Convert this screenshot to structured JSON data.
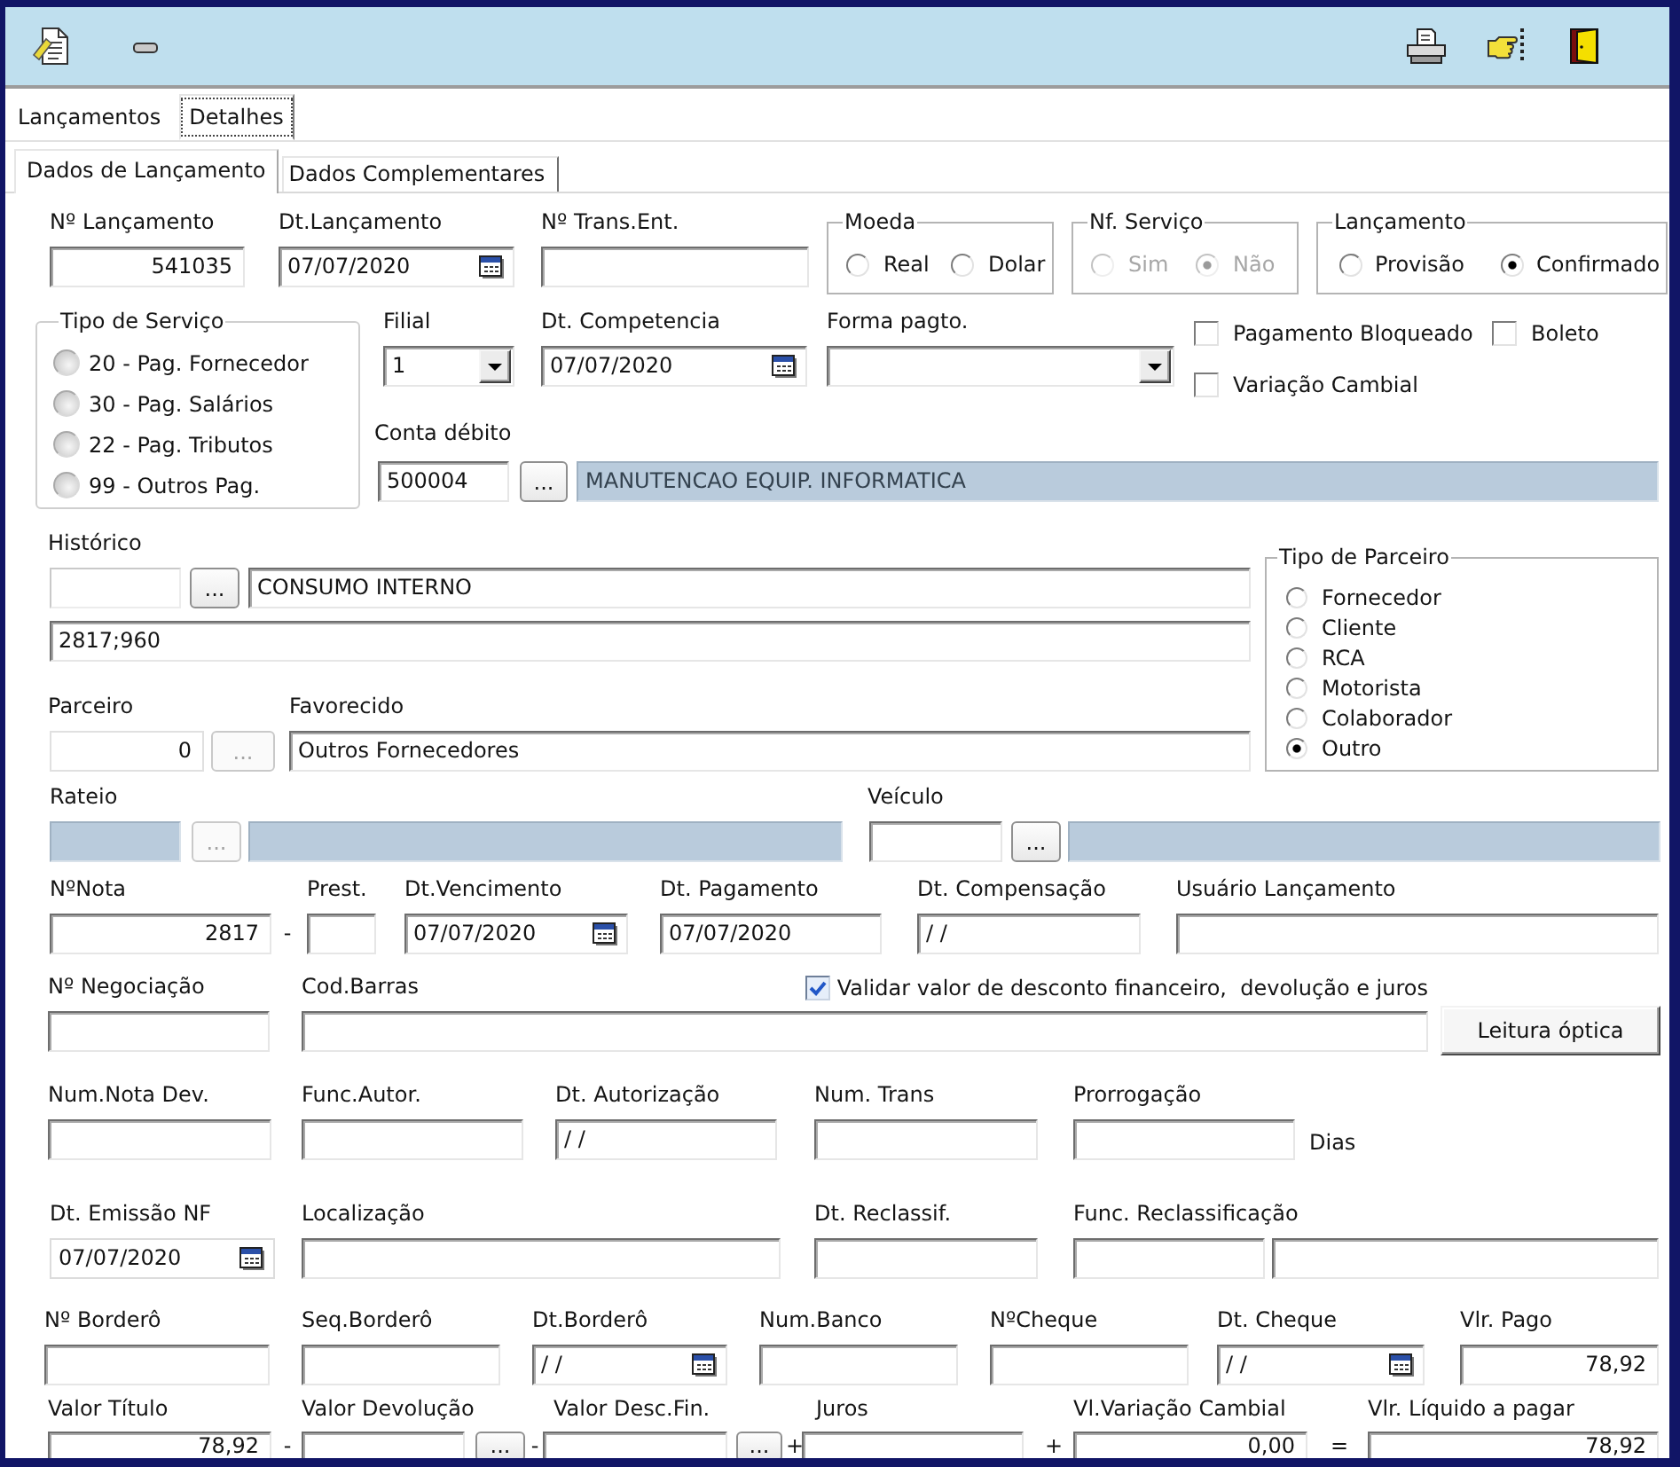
{
  "tabs": [
    {
      "label": "Lançamentos",
      "selected": false
    },
    {
      "label": "Detalhes",
      "selected": true
    }
  ],
  "subtabs": [
    {
      "label": "Dados de Lançamento",
      "selected": true
    },
    {
      "label": "Dados Complementares",
      "selected": false
    }
  ],
  "header": {
    "fields": [
      {
        "kind": "number",
        "label": "Nº Lançamento",
        "value": "541035"
      },
      {
        "kind": "date",
        "label": "Dt.Lançamento",
        "value": "07/07/2020"
      },
      {
        "kind": "text",
        "label": "Nº Trans.Ent."
      }
    ],
    "groups": [
      {
        "kind": "radios",
        "title": "Moeda",
        "disabled": false,
        "options": [
          {
            "label": "Real",
            "selected": false
          },
          {
            "label": "Dolar",
            "selected": false
          }
        ]
      },
      {
        "kind": "radios",
        "title": "Nf. Serviço",
        "disabled": true,
        "options": [
          {
            "label": "Sim",
            "selected": false
          },
          {
            "label": "Não",
            "selected": true
          }
        ]
      },
      {
        "kind": "radios",
        "title": "Lançamento",
        "disabled": false,
        "options": [
          {
            "label": "Provisão",
            "selected": false
          },
          {
            "label": "Confirmado",
            "selected": true
          }
        ]
      }
    ]
  },
  "service": {
    "kind": "radios",
    "title": "Tipo de Serviço",
    "options": [
      {
        "label": "20 - Pag. Fornecedor",
        "selected": false
      },
      {
        "label": "30 - Pag. Salários",
        "selected": false
      },
      {
        "label": "22 - Pag. Tributos",
        "selected": false
      },
      {
        "label": "99 - Outros Pag.",
        "selected": false
      }
    ]
  },
  "payment": {
    "fields": [
      {
        "kind": "combo",
        "label": "Filial",
        "value": "1"
      },
      {
        "kind": "date",
        "label": "Dt. Competencia",
        "value": "07/07/2020"
      },
      {
        "kind": "combo",
        "label": "Forma pagto."
      }
    ],
    "checks": [
      {
        "label": "Pagamento Bloqueado",
        "checked": false
      },
      {
        "label": "Boleto",
        "checked": false
      },
      {
        "label": "Variação Cambial",
        "checked": false
      }
    ]
  },
  "conta_debito": {
    "kind": "lookup",
    "label": "Conta débito",
    "field": {
      "value": "500004",
      "disabled": false
    },
    "button": {
      "text": "...",
      "disabled": false
    },
    "description": {
      "value": "MANUTENCAO EQUIP. INFORMATICA",
      "disabled": true
    }
  },
  "historico": {
    "kind": "lookup",
    "label": "Histórico",
    "field": {
      "disabled": false
    },
    "button": {
      "text": "...",
      "disabled": false
    },
    "description": {
      "value": "CONSUMO INTERNO",
      "disabled": false
    },
    "complement": "2817;960"
  },
  "partner": {
    "fields": [
      {
        "kind": "lookup",
        "label": "Parceiro",
        "field": {
          "value": "0",
          "disabled": false
        },
        "button": {
          "text": "...",
          "disabled": true
        }
      },
      {
        "kind": "text",
        "label": "Favorecido",
        "value": "Outros Fornecedores"
      }
    ]
  },
  "partner_type": {
    "kind": "radios",
    "title": "Tipo de Parceiro",
    "options": [
      {
        "label": "Fornecedor",
        "selected": false
      },
      {
        "label": "Cliente",
        "selected": false
      },
      {
        "label": "RCA",
        "selected": false
      },
      {
        "label": "Motorista",
        "selected": false
      },
      {
        "label": "Colaborador",
        "selected": false
      },
      {
        "label": "Outro",
        "selected": true
      }
    ]
  },
  "links": [
    {
      "kind": "lookup",
      "label": "Rateio",
      "field": {
        "disabled": true
      },
      "button": {
        "text": "...",
        "disabled": true
      },
      "description": {
        "disabled": true
      }
    },
    {
      "kind": "lookup",
      "label": "Veículo",
      "field": {
        "disabled": false
      },
      "button": {
        "text": "...",
        "disabled": false
      },
      "description": {
        "disabled": true
      }
    }
  ],
  "rows": [
    [
      {
        "kind": "number",
        "label": "NºNota",
        "value": "2817"
      },
      {
        "kind": "op",
        "text": "-"
      },
      {
        "kind": "text",
        "label": "Prest."
      },
      {
        "kind": "date",
        "label": "Dt.Vencimento",
        "value": "07/07/2020"
      },
      {
        "kind": "text",
        "label": "Dt. Pagamento",
        "value": "07/07/2020"
      },
      {
        "kind": "text",
        "label": "Dt. Compensação",
        "value": "/ /"
      },
      {
        "kind": "text",
        "label": "Usuário Lançamento"
      }
    ],
    [
      {
        "kind": "text",
        "label": "Nº Negociação"
      },
      {
        "kind": "barcode",
        "label": "Cod.Barras",
        "check": {
          "label": "Validar valor de desconto financeiro,  devolução e juros",
          "checked": true
        }
      },
      {
        "kind": "button",
        "text": "Leitura óptica"
      }
    ],
    [
      {
        "kind": "text",
        "label": "Num.Nota Dev."
      },
      {
        "kind": "text",
        "label": "Func.Autor."
      },
      {
        "kind": "text",
        "label": "Dt. Autorização",
        "value": "/ /"
      },
      {
        "kind": "text",
        "label": "Num. Trans"
      },
      {
        "kind": "text",
        "label": "Prorrogação"
      },
      {
        "kind": "unit",
        "text": "Dias"
      }
    ],
    [
      {
        "kind": "date",
        "label": "Dt. Emissão NF",
        "value": "07/07/2020"
      },
      {
        "kind": "text",
        "label": "Localização"
      },
      {
        "kind": "text",
        "label": "Dt. Reclassif."
      },
      {
        "kind": "pair",
        "label": "Func. Reclassificação"
      }
    ],
    [
      {
        "kind": "text",
        "label": "Nº Borderô"
      },
      {
        "kind": "text",
        "label": "Seq.Borderô"
      },
      {
        "kind": "date",
        "label": "Dt.Borderô",
        "value": "/ /"
      },
      {
        "kind": "text",
        "label": "Num.Banco"
      },
      {
        "kind": "text",
        "label": "NºCheque"
      },
      {
        "kind": "date",
        "label": "Dt. Cheque",
        "value": "/ /"
      },
      {
        "kind": "number",
        "label": "Vlr. Pago",
        "value": "78,92"
      }
    ],
    [
      {
        "kind": "number",
        "label": "Valor Título",
        "value": "78,92"
      },
      {
        "kind": "op",
        "text": "-"
      },
      {
        "kind": "lookup",
        "label": "Valor Devolução",
        "field": {
          "disabled": false
        },
        "button": {
          "text": "...",
          "disabled": false
        }
      },
      {
        "kind": "op",
        "text": "-"
      },
      {
        "kind": "lookup",
        "label": "Valor Desc.Fin.",
        "field": {
          "disabled": false
        },
        "button": {
          "text": "...",
          "disabled": false
        }
      },
      {
        "kind": "op",
        "text": "+"
      },
      {
        "kind": "text",
        "label": "Juros"
      },
      {
        "kind": "op",
        "text": "+"
      },
      {
        "kind": "number",
        "label": "Vl.Variação Cambial",
        "value": "0,00"
      },
      {
        "kind": "op",
        "text": "="
      },
      {
        "kind": "number",
        "label": "Vlr. Líquido a pagar",
        "value": "78,92"
      }
    ]
  ]
}
